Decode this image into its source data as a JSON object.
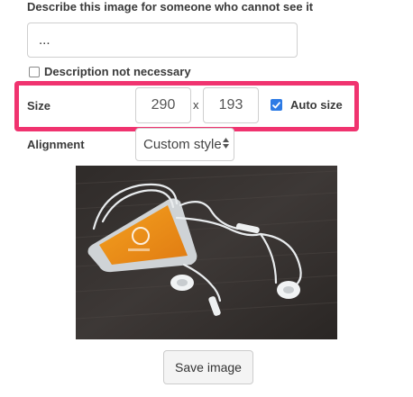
{
  "description": {
    "label": "Describe this image for someone who cannot see it",
    "value": "...",
    "not_necessary_label": "Description not necessary",
    "not_necessary_checked": false
  },
  "size": {
    "label": "Size",
    "width": "290",
    "height": "193",
    "separator": "x",
    "auto_size_label": "Auto size",
    "auto_size_checked": true
  },
  "alignment": {
    "label": "Alignment",
    "selected": "Custom style"
  },
  "image": {
    "icon": "photo-earphones-smartphone"
  },
  "save_button": {
    "label": "Save image"
  },
  "colors": {
    "highlight": "#f0336f",
    "checkbox": "#2d7be5"
  }
}
